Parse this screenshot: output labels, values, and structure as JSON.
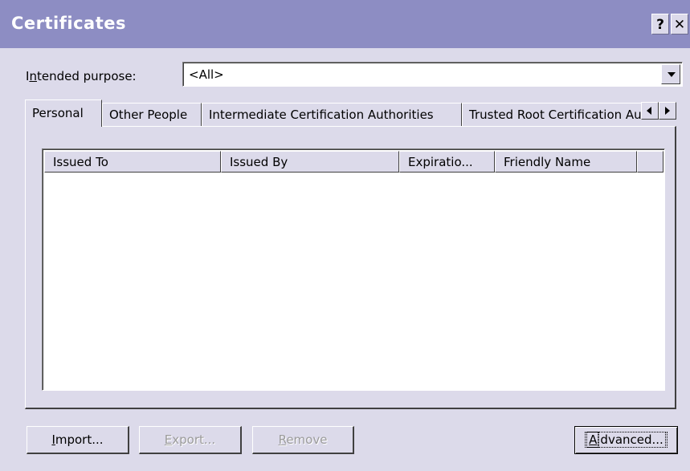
{
  "window": {
    "title": "Certificates",
    "help_label": "?",
    "close_label": "✕"
  },
  "purpose": {
    "label_prefix": "I",
    "label_accel": "n",
    "label_rest": "tended purpose:",
    "value": "<All>"
  },
  "tabs": [
    {
      "label": "Personal"
    },
    {
      "label": "Other People"
    },
    {
      "label": "Intermediate Certification Authorities"
    },
    {
      "label": "Trusted Root Certification Authorities"
    }
  ],
  "columns": [
    {
      "label": "Issued To"
    },
    {
      "label": "Issued By"
    },
    {
      "label": "Expiratio..."
    },
    {
      "label": "Friendly Name"
    }
  ],
  "buttons": {
    "import": {
      "accel": "I",
      "rest": "mport..."
    },
    "export": {
      "accel": "E",
      "rest": "xport..."
    },
    "remove": {
      "accel": "R",
      "rest": "emove"
    },
    "advanced": {
      "accel": "A",
      "rest": "dvanced..."
    }
  }
}
